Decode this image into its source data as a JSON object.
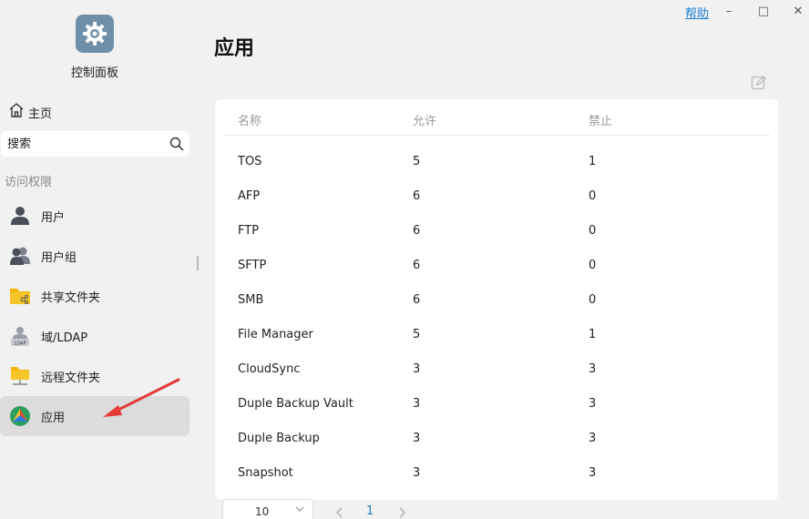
{
  "window": {
    "help": "帮助",
    "minimize": "–",
    "maximize": "□",
    "close": "✕"
  },
  "sidebar": {
    "app_title": "控制面板",
    "home_label": "主页",
    "search_placeholder": "搜索",
    "section_label": "访问权限",
    "items": [
      {
        "label": "用户",
        "icon": "user-icon"
      },
      {
        "label": "用户组",
        "icon": "user-group-icon"
      },
      {
        "label": "共享文件夹",
        "icon": "shared-folder-icon"
      },
      {
        "label": "域/LDAP",
        "icon": "ldap-icon"
      },
      {
        "label": "远程文件夹",
        "icon": "remote-folder-icon"
      },
      {
        "label": "应用",
        "icon": "app-icon",
        "active": true
      }
    ]
  },
  "main": {
    "title": "应用",
    "table": {
      "columns": [
        "名称",
        "允许",
        "禁止"
      ],
      "rows": [
        [
          "TOS",
          "5",
          "1"
        ],
        [
          "AFP",
          "6",
          "0"
        ],
        [
          "FTP",
          "6",
          "0"
        ],
        [
          "SFTP",
          "6",
          "0"
        ],
        [
          "SMB",
          "6",
          "0"
        ],
        [
          "File Manager",
          "5",
          "1"
        ],
        [
          "CloudSync",
          "3",
          "3"
        ],
        [
          "Duple Backup Vault",
          "3",
          "3"
        ],
        [
          "Duple Backup",
          "3",
          "3"
        ],
        [
          "Snapshot",
          "3",
          "3"
        ]
      ]
    },
    "pagination": {
      "page_size": "10",
      "current_page": "1"
    }
  },
  "colors": {
    "accent": "#1e7fd1",
    "annotation": "#e53935",
    "active_bg": "#dcdcdc"
  }
}
